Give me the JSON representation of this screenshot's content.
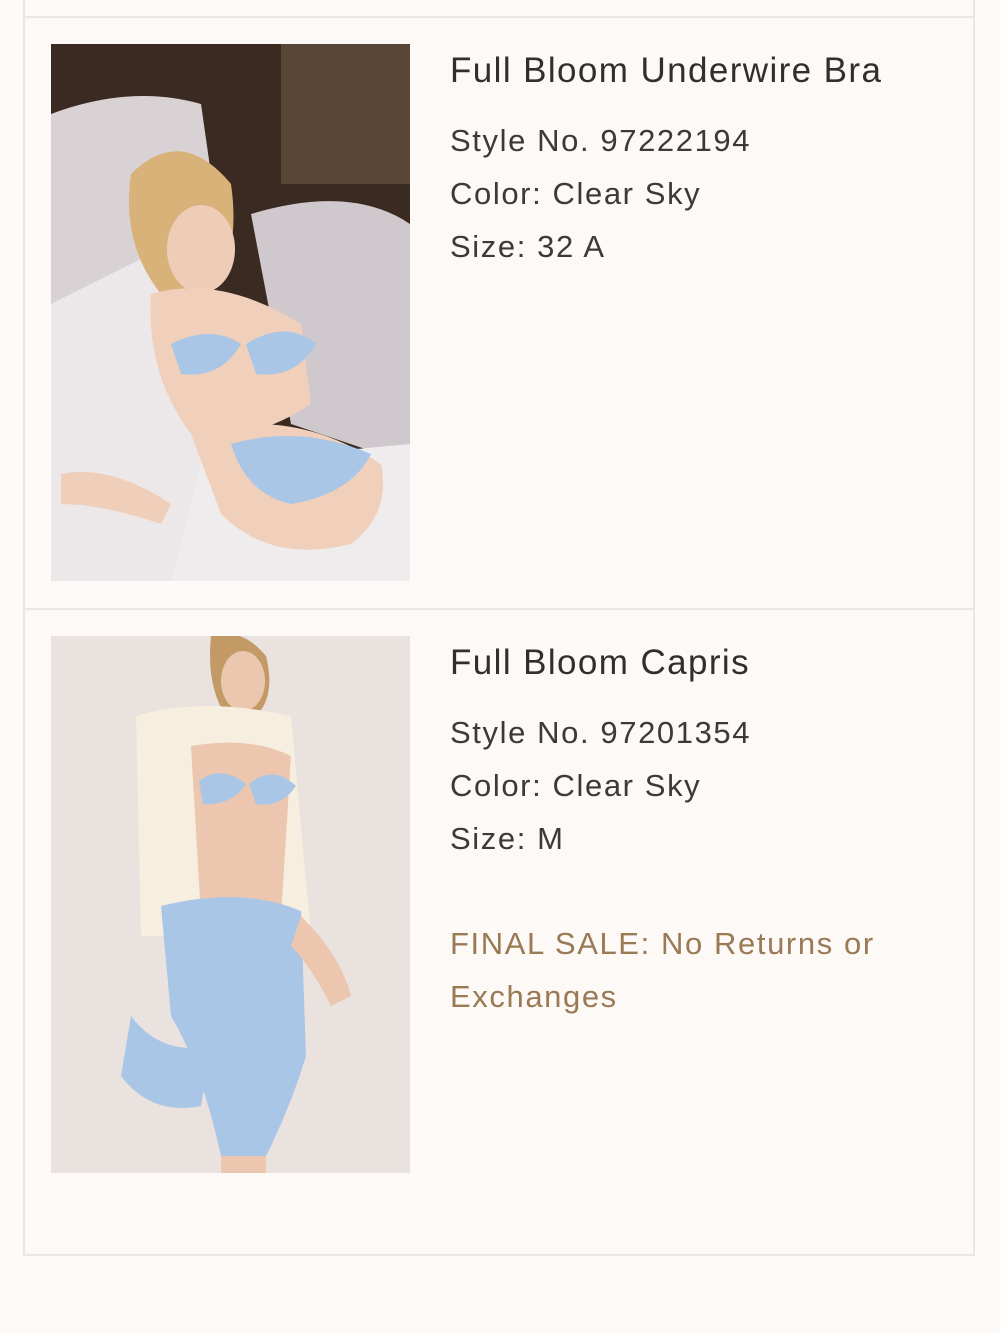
{
  "colors": {
    "background": "#fcf9f6",
    "divider": "#ebe7e2",
    "text": "#333333",
    "final_sale": "#9a7a55"
  },
  "items": [
    {
      "title": "Full Bloom Underwire Bra",
      "style_no": "Style No. 97222194",
      "color": "Color: Clear Sky",
      "size": "Size: 32 A"
    },
    {
      "title": "Full Bloom Capris",
      "style_no": "Style No. 97201354",
      "color": "Color: Clear Sky",
      "size": "Size: M",
      "notice": "FINAL SALE: No Returns or Exchanges"
    }
  ]
}
